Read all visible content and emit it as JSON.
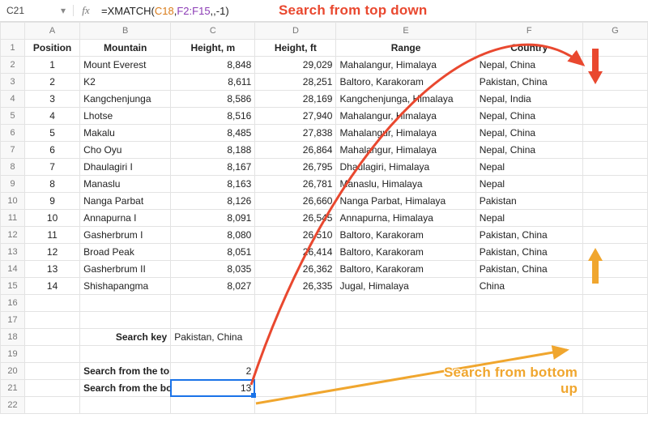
{
  "name_box": "C21",
  "formula_parts": {
    "prefix": "=",
    "fn": "XMATCH",
    "open": "(",
    "arg1": "C18",
    "sep1": ",",
    "arg2": "F2:F15",
    "sep2": ",,",
    "arg3": "-1",
    "close": ")"
  },
  "columns": [
    "A",
    "B",
    "C",
    "D",
    "E",
    "F",
    "G"
  ],
  "headers": {
    "A": "Position",
    "B": "Mountain",
    "C": "Height, m",
    "D": "Height, ft",
    "E": "Range",
    "F": "Country"
  },
  "rows": [
    {
      "n": 1,
      "pos": "1",
      "mtn": "Mount Everest",
      "hm": "8,848",
      "hf": "29,029",
      "rng": "Mahalangur, Himalaya",
      "cty": "Nepal, China"
    },
    {
      "n": 2,
      "pos": "2",
      "mtn": "K2",
      "hm": "8,611",
      "hf": "28,251",
      "rng": "Baltoro, Karakoram",
      "cty": "Pakistan, China"
    },
    {
      "n": 3,
      "pos": "3",
      "mtn": "Kangchenjunga",
      "hm": "8,586",
      "hf": "28,169",
      "rng": "Kangchenjunga, Himalaya",
      "cty": "Nepal, India"
    },
    {
      "n": 4,
      "pos": "4",
      "mtn": "Lhotse",
      "hm": "8,516",
      "hf": "27,940",
      "rng": "Mahalangur, Himalaya",
      "cty": "Nepal, China"
    },
    {
      "n": 5,
      "pos": "5",
      "mtn": "Makalu",
      "hm": "8,485",
      "hf": "27,838",
      "rng": "Mahalangur, Himalaya",
      "cty": "Nepal, China"
    },
    {
      "n": 6,
      "pos": "6",
      "mtn": "Cho Oyu",
      "hm": "8,188",
      "hf": "26,864",
      "rng": "Mahalangur, Himalaya",
      "cty": "Nepal, China"
    },
    {
      "n": 7,
      "pos": "7",
      "mtn": "Dhaulagiri I",
      "hm": "8,167",
      "hf": "26,795",
      "rng": "Dhaulagiri, Himalaya",
      "cty": "Nepal"
    },
    {
      "n": 8,
      "pos": "8",
      "mtn": "Manaslu",
      "hm": "8,163",
      "hf": "26,781",
      "rng": "Manaslu, Himalaya",
      "cty": "Nepal"
    },
    {
      "n": 9,
      "pos": "9",
      "mtn": "Nanga Parbat",
      "hm": "8,126",
      "hf": "26,660",
      "rng": "Nanga Parbat, Himalaya",
      "cty": "Pakistan"
    },
    {
      "n": 10,
      "pos": "10",
      "mtn": "Annapurna I",
      "hm": "8,091",
      "hf": "26,545",
      "rng": "Annapurna, Himalaya",
      "cty": "Nepal"
    },
    {
      "n": 11,
      "pos": "11",
      "mtn": "Gasherbrum I",
      "hm": "8,080",
      "hf": "26,510",
      "rng": "Baltoro, Karakoram",
      "cty": "Pakistan, China"
    },
    {
      "n": 12,
      "pos": "12",
      "mtn": "Broad Peak",
      "hm": "8,051",
      "hf": "26,414",
      "rng": "Baltoro, Karakoram",
      "cty": "Pakistan, China"
    },
    {
      "n": 13,
      "pos": "13",
      "mtn": "Gasherbrum II",
      "hm": "8,035",
      "hf": "26,362",
      "rng": "Baltoro, Karakoram",
      "cty": "Pakistan, China"
    },
    {
      "n": 14,
      "pos": "14",
      "mtn": "Shishapangma",
      "hm": "8,027",
      "hf": "26,335",
      "rng": "Jugal, Himalaya",
      "cty": "China"
    }
  ],
  "search": {
    "key_label": "Search key",
    "key_value": "Pakistan, China",
    "top_label": "Search from the top",
    "top_value": "2",
    "bottom_label": "Search from the bottom",
    "bottom_value": "13"
  },
  "annotations": {
    "top": "Search from top down",
    "bottom_l1": "Search from bottom",
    "bottom_l2": "up"
  },
  "colors": {
    "red": "#e9482f",
    "orange": "#f0a62e",
    "sel": "#1a73e8"
  }
}
